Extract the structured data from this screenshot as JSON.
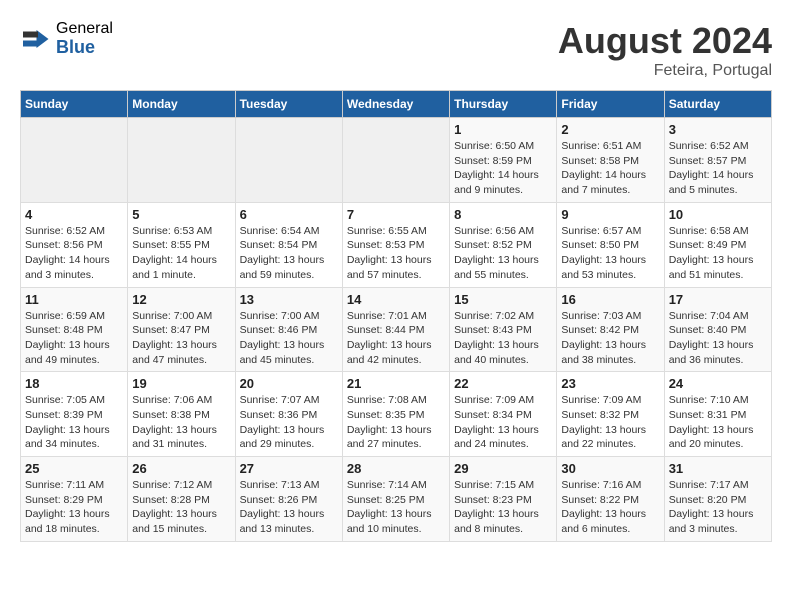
{
  "header": {
    "logo_general": "General",
    "logo_blue": "Blue",
    "main_title": "August 2024",
    "subtitle": "Feteira, Portugal"
  },
  "calendar": {
    "headers": [
      "Sunday",
      "Monday",
      "Tuesday",
      "Wednesday",
      "Thursday",
      "Friday",
      "Saturday"
    ],
    "weeks": [
      [
        {
          "day": "",
          "info": ""
        },
        {
          "day": "",
          "info": ""
        },
        {
          "day": "",
          "info": ""
        },
        {
          "day": "",
          "info": ""
        },
        {
          "day": "1",
          "info": "Sunrise: 6:50 AM\nSunset: 8:59 PM\nDaylight: 14 hours\nand 9 minutes."
        },
        {
          "day": "2",
          "info": "Sunrise: 6:51 AM\nSunset: 8:58 PM\nDaylight: 14 hours\nand 7 minutes."
        },
        {
          "day": "3",
          "info": "Sunrise: 6:52 AM\nSunset: 8:57 PM\nDaylight: 14 hours\nand 5 minutes."
        }
      ],
      [
        {
          "day": "4",
          "info": "Sunrise: 6:52 AM\nSunset: 8:56 PM\nDaylight: 14 hours\nand 3 minutes."
        },
        {
          "day": "5",
          "info": "Sunrise: 6:53 AM\nSunset: 8:55 PM\nDaylight: 14 hours\nand 1 minute."
        },
        {
          "day": "6",
          "info": "Sunrise: 6:54 AM\nSunset: 8:54 PM\nDaylight: 13 hours\nand 59 minutes."
        },
        {
          "day": "7",
          "info": "Sunrise: 6:55 AM\nSunset: 8:53 PM\nDaylight: 13 hours\nand 57 minutes."
        },
        {
          "day": "8",
          "info": "Sunrise: 6:56 AM\nSunset: 8:52 PM\nDaylight: 13 hours\nand 55 minutes."
        },
        {
          "day": "9",
          "info": "Sunrise: 6:57 AM\nSunset: 8:50 PM\nDaylight: 13 hours\nand 53 minutes."
        },
        {
          "day": "10",
          "info": "Sunrise: 6:58 AM\nSunset: 8:49 PM\nDaylight: 13 hours\nand 51 minutes."
        }
      ],
      [
        {
          "day": "11",
          "info": "Sunrise: 6:59 AM\nSunset: 8:48 PM\nDaylight: 13 hours\nand 49 minutes."
        },
        {
          "day": "12",
          "info": "Sunrise: 7:00 AM\nSunset: 8:47 PM\nDaylight: 13 hours\nand 47 minutes."
        },
        {
          "day": "13",
          "info": "Sunrise: 7:00 AM\nSunset: 8:46 PM\nDaylight: 13 hours\nand 45 minutes."
        },
        {
          "day": "14",
          "info": "Sunrise: 7:01 AM\nSunset: 8:44 PM\nDaylight: 13 hours\nand 42 minutes."
        },
        {
          "day": "15",
          "info": "Sunrise: 7:02 AM\nSunset: 8:43 PM\nDaylight: 13 hours\nand 40 minutes."
        },
        {
          "day": "16",
          "info": "Sunrise: 7:03 AM\nSunset: 8:42 PM\nDaylight: 13 hours\nand 38 minutes."
        },
        {
          "day": "17",
          "info": "Sunrise: 7:04 AM\nSunset: 8:40 PM\nDaylight: 13 hours\nand 36 minutes."
        }
      ],
      [
        {
          "day": "18",
          "info": "Sunrise: 7:05 AM\nSunset: 8:39 PM\nDaylight: 13 hours\nand 34 minutes."
        },
        {
          "day": "19",
          "info": "Sunrise: 7:06 AM\nSunset: 8:38 PM\nDaylight: 13 hours\nand 31 minutes."
        },
        {
          "day": "20",
          "info": "Sunrise: 7:07 AM\nSunset: 8:36 PM\nDaylight: 13 hours\nand 29 minutes."
        },
        {
          "day": "21",
          "info": "Sunrise: 7:08 AM\nSunset: 8:35 PM\nDaylight: 13 hours\nand 27 minutes."
        },
        {
          "day": "22",
          "info": "Sunrise: 7:09 AM\nSunset: 8:34 PM\nDaylight: 13 hours\nand 24 minutes."
        },
        {
          "day": "23",
          "info": "Sunrise: 7:09 AM\nSunset: 8:32 PM\nDaylight: 13 hours\nand 22 minutes."
        },
        {
          "day": "24",
          "info": "Sunrise: 7:10 AM\nSunset: 8:31 PM\nDaylight: 13 hours\nand 20 minutes."
        }
      ],
      [
        {
          "day": "25",
          "info": "Sunrise: 7:11 AM\nSunset: 8:29 PM\nDaylight: 13 hours\nand 18 minutes."
        },
        {
          "day": "26",
          "info": "Sunrise: 7:12 AM\nSunset: 8:28 PM\nDaylight: 13 hours\nand 15 minutes."
        },
        {
          "day": "27",
          "info": "Sunrise: 7:13 AM\nSunset: 8:26 PM\nDaylight: 13 hours\nand 13 minutes."
        },
        {
          "day": "28",
          "info": "Sunrise: 7:14 AM\nSunset: 8:25 PM\nDaylight: 13 hours\nand 10 minutes."
        },
        {
          "day": "29",
          "info": "Sunrise: 7:15 AM\nSunset: 8:23 PM\nDaylight: 13 hours\nand 8 minutes."
        },
        {
          "day": "30",
          "info": "Sunrise: 7:16 AM\nSunset: 8:22 PM\nDaylight: 13 hours\nand 6 minutes."
        },
        {
          "day": "31",
          "info": "Sunrise: 7:17 AM\nSunset: 8:20 PM\nDaylight: 13 hours\nand 3 minutes."
        }
      ]
    ]
  }
}
